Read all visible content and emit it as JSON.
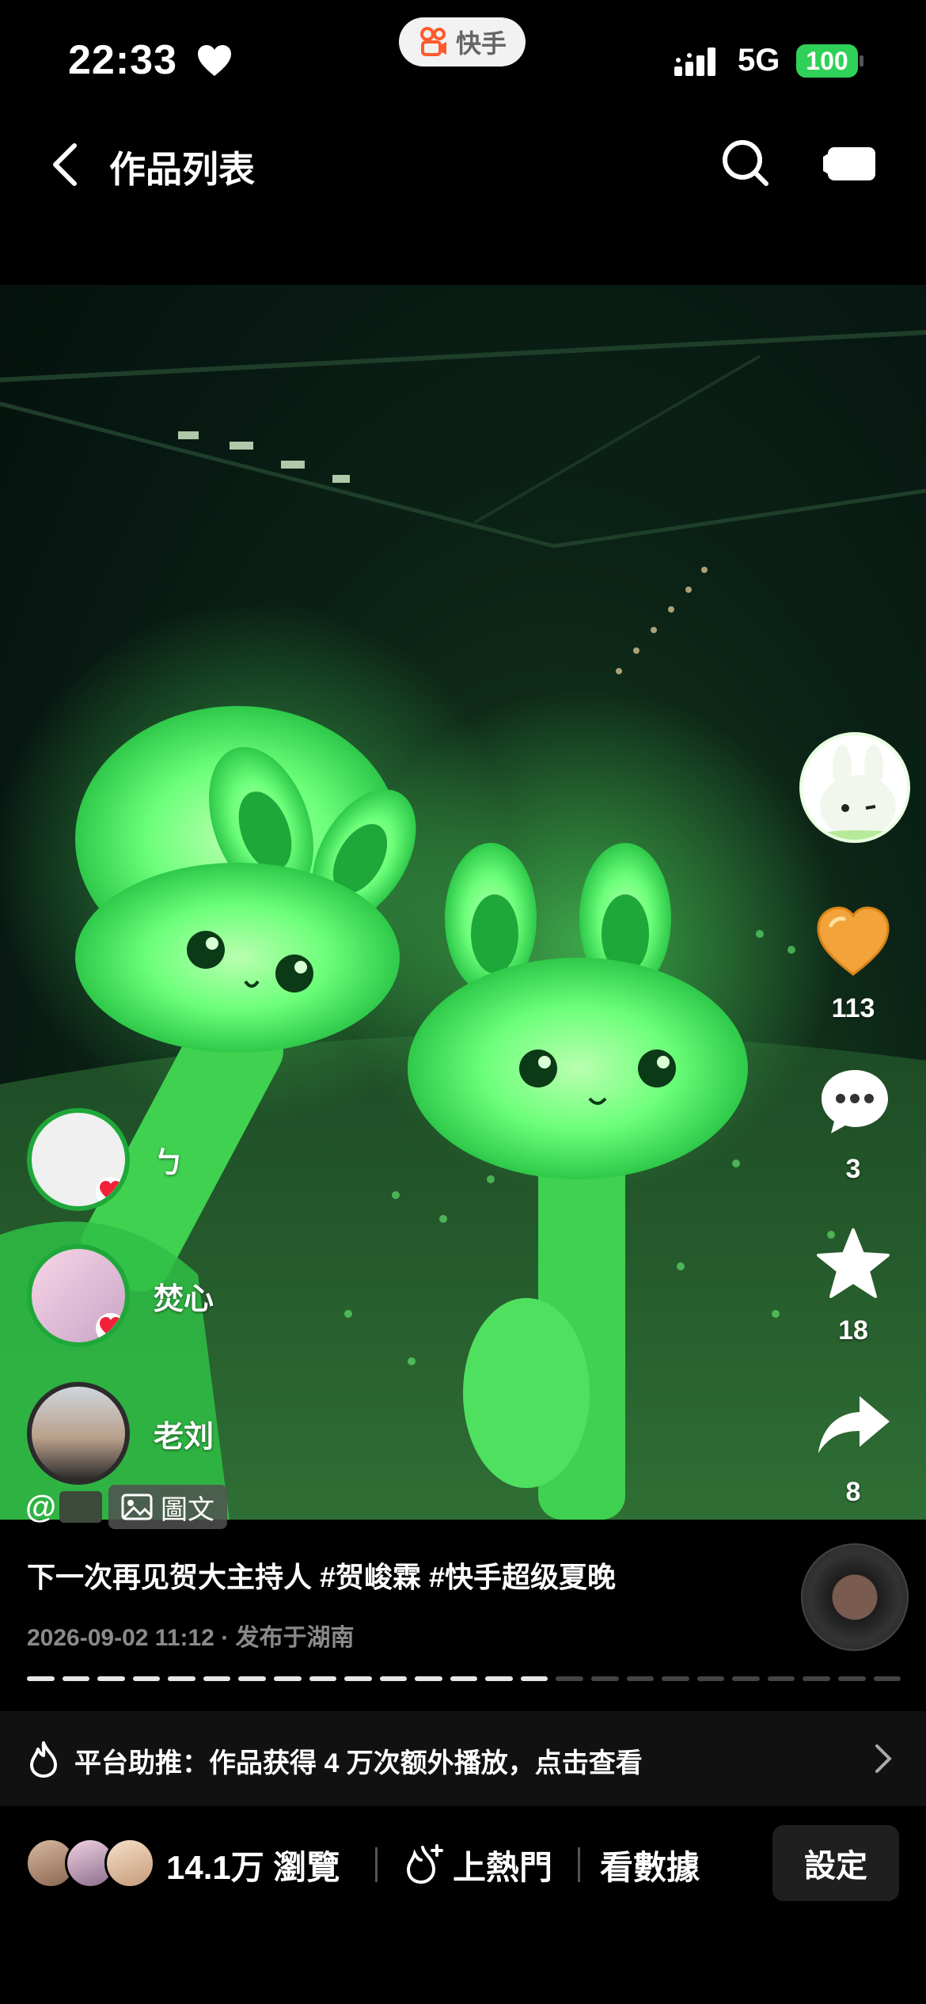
{
  "status_bar": {
    "time": "22:33",
    "app_name": "快手",
    "network": "5G",
    "battery": "100"
  },
  "header": {
    "title": "作品列表"
  },
  "actions": {
    "likes": "113",
    "comments": "3",
    "favorites": "18",
    "shares": "8"
  },
  "viewers": [
    {
      "name": "ㄅ"
    },
    {
      "name": "焚心"
    },
    {
      "name": "老刘"
    }
  ],
  "post": {
    "at_symbol": "@",
    "type_tag": "圖文",
    "caption": "下一次再见贺大主持人 #贺峻霖 #快手超级夏晚",
    "timestamp": "2026-09-02 11:12",
    "location": "· 发布于湖南"
  },
  "progress": {
    "total_segments": 25,
    "current_segment": 15
  },
  "promo": {
    "text": "平台助推：作品获得 4 万次额外播放，点击查看"
  },
  "bottom_bar": {
    "views": "14.1万 瀏覽",
    "hot": "上熱門",
    "stats": "看數據",
    "settings": "設定"
  },
  "colors": {
    "accent_green": "#1fa83a",
    "battery_green": "#30d158",
    "glow_green": "#6dff7a"
  }
}
